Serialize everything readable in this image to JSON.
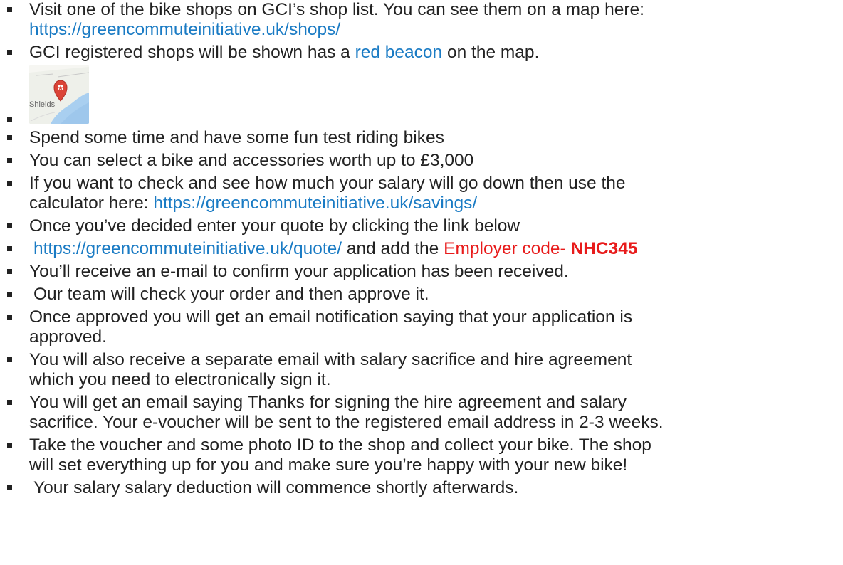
{
  "steps": [
    {
      "lines": [
        "Visit one of the bike shops on GCI’s shop list. You can see them on a map here:"
      ],
      "link": "https://greencommuteinitiative.uk/shops/"
    },
    {
      "text": "GCI registered shops will be shown has a ",
      "link": "red beacon",
      "suffix": " on the map."
    },
    {
      "map_label": "Shields"
    },
    {
      "text": "Spend some time and have some fun test riding bikes"
    },
    {
      "text": "You can select a bike and accessories worth up to £3,000"
    },
    {
      "line1": "If you want to check and see how much your salary will go down then use the",
      "line2_prefix": "calculator here: ",
      "link": "https://greencommuteinitiative.uk/savings/"
    },
    {
      "text": "Once you’ve decided enter your quote by clicking the link below"
    },
    {
      "link": "https://greencommuteinitiative.uk/quote/",
      "middle": " and add the ",
      "employer_label": "Employer code- ",
      "employer_code": "NHC345"
    },
    {
      "text": "You’ll receive an e-mail to confirm your application has been received."
    },
    {
      "text": "Our team will check your order and then approve it."
    },
    {
      "line1": "Once approved you will get an email notification saying that your application is",
      "line2": "approved."
    },
    {
      "line1": "You will also receive a separate email with salary sacrifice and hire agreement",
      "line2": "which you need to electronically sign it."
    },
    {
      "line1": "You will get an email saying Thanks for signing the hire agreement and salary",
      "line2": "sacrifice. Your e-voucher will be sent to the registered email address in 2-3 weeks."
    },
    {
      "line1": "Take the voucher and some photo ID to the shop and collect your bike. The shop",
      "line2": "will set everything up for you and make sure you’re happy with your new bike!"
    },
    {
      "text": "Your salary salary deduction will commence shortly afterwards."
    }
  ],
  "colors": {
    "text": "#222222",
    "link": "#1a7bc4",
    "employer_red": "#e81b1b",
    "map_water": "#a9cff0",
    "map_land": "#eef0ea",
    "map_pin": "#db4437"
  }
}
